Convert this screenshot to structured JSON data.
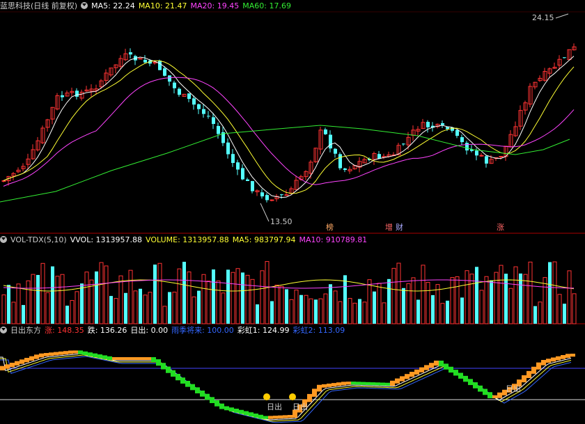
{
  "panel1": {
    "title": "蓝思科技(日线 前复权)",
    "ma": [
      {
        "label": "MA5: 22.24",
        "color": "#ffffff"
      },
      {
        "label": "MA10: 21.47",
        "color": "#ffff33"
      },
      {
        "label": "MA20: 19.45",
        "color": "#ff44ff"
      },
      {
        "label": "MA60: 17.69",
        "color": "#33ee33"
      }
    ],
    "high_label": "24.15",
    "low_label": "13.50",
    "tags": [
      "榜",
      "增",
      "财",
      "涨"
    ]
  },
  "panel2": {
    "title": "VOL-TDX(5,10)",
    "items": [
      {
        "label": "VVOL: 1313957.88",
        "color": "#ffffff"
      },
      {
        "label": "VOLUME: 1313957.88",
        "color": "#ffff33"
      },
      {
        "label": "MA5: 983797.94",
        "color": "#ffff33"
      },
      {
        "label": "MA10: 910789.81",
        "color": "#ff44ff"
      }
    ]
  },
  "panel3": {
    "title": "日出东方",
    "items": [
      {
        "label": "涨: 148.35",
        "color": "#ff3333"
      },
      {
        "label": "跌: 136.26",
        "color": "#ffffff"
      },
      {
        "label": "日出: 0.00",
        "color": "#ffffff"
      },
      {
        "label": "雨季将来: 100.00",
        "color": "#3366ff"
      },
      {
        "label": "彩虹1: 124.99",
        "color": "#ffffff"
      },
      {
        "label": "彩虹2: 113.09",
        "color": "#3366ff"
      }
    ],
    "markers": [
      "日出",
      "日出",
      "日出"
    ]
  },
  "colors": {
    "up": "#ff3333",
    "down": "#54ffff",
    "ma5": "#ffffff",
    "ma10": "#ffff33",
    "ma20": "#ff44ff",
    "ma60": "#33ee33",
    "divider": "#aa0000",
    "orange": "#ff9922",
    "green": "#22dd22"
  }
}
